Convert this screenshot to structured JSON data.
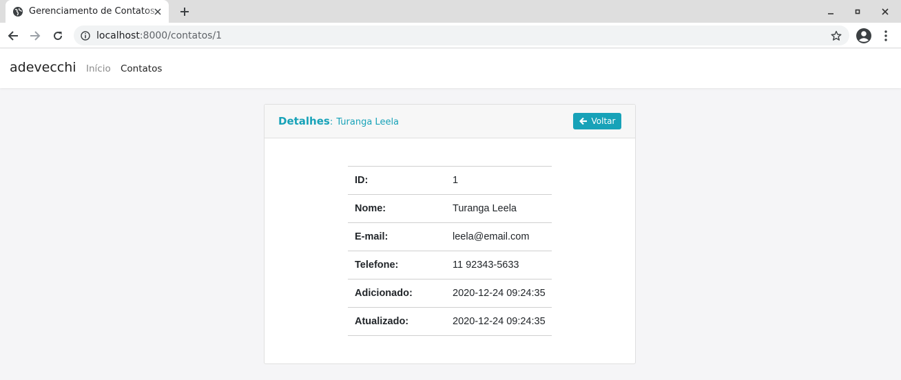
{
  "browser": {
    "tab_title": "Gerenciamento de Contatos",
    "url_host": "localhost",
    "url_path": ":8000/contatos/1"
  },
  "navbar": {
    "brand": "adevecchi",
    "links": [
      {
        "label": "Início",
        "active": false
      },
      {
        "label": "Contatos",
        "active": true
      }
    ]
  },
  "card": {
    "title": "Detalhes",
    "separator": ":",
    "subtitle": "Turanga Leela",
    "back_button": "Voltar",
    "accent_color": "#17a2b8",
    "rows": [
      {
        "key": "ID:",
        "value": "1"
      },
      {
        "key": "Nome:",
        "value": "Turanga Leela"
      },
      {
        "key": "E-mail:",
        "value": "leela@email.com"
      },
      {
        "key": "Telefone:",
        "value": "11 92343-5633"
      },
      {
        "key": "Adicionado:",
        "value": "2020-12-24 09:24:35"
      },
      {
        "key": "Atualizado:",
        "value": "2020-12-24 09:24:35"
      }
    ]
  }
}
